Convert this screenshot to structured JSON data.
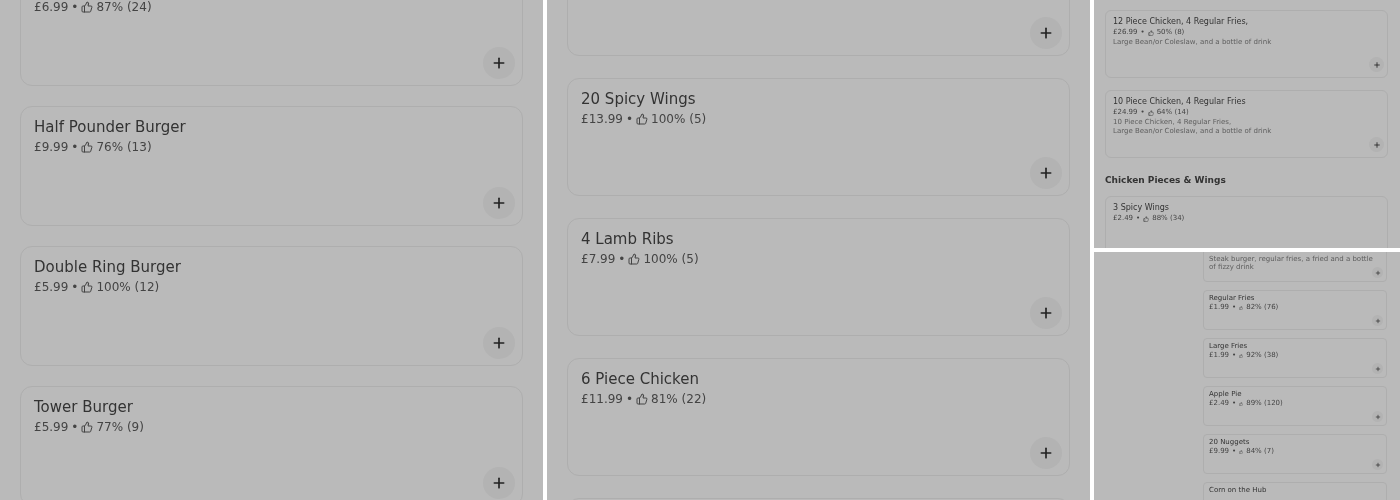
{
  "panels": [
    {
      "items": [
        {
          "kind": "item",
          "price": "£6.99",
          "rating": "87% (24)",
          "add_button": true
        },
        {
          "kind": "item",
          "name": "Half Pounder Burger",
          "price": "£9.99",
          "rating": "76% (13)",
          "add_button": true
        },
        {
          "kind": "item",
          "name": "Double Ring Burger",
          "price": "£5.99",
          "rating": "100% (12)",
          "add_button": true
        },
        {
          "kind": "item",
          "name": "Tower Burger",
          "price": "£5.99",
          "rating": "77% (9)",
          "add_button": true
        }
      ]
    },
    {
      "items": [
        {
          "kind": "item",
          "add_button": true
        },
        {
          "kind": "item",
          "name": "20 Spicy Wings",
          "price": "£13.99",
          "rating": "100% (5)",
          "add_button": true
        },
        {
          "kind": "item",
          "name": "4 Lamb Ribs",
          "price": "£7.99",
          "rating": "100% (5)",
          "add_button": true
        },
        {
          "kind": "item",
          "name": "6 Piece Chicken",
          "price": "£11.99",
          "rating": "81% (22)",
          "add_button": true
        },
        {
          "kind": "item"
        }
      ]
    },
    {
      "items": [
        {
          "kind": "item",
          "name": "12 Piece Chicken, 4 Regular Fries,",
          "price": "£26.99",
          "rating": "50% (8)",
          "description": "Large Bean/or Coleslaw, and a bottle of drink",
          "add_button": true
        },
        {
          "kind": "item",
          "name": "10 Piece Chicken, 4 Regular Fries",
          "price": "£24.99",
          "rating": "64% (14)",
          "description": "10 Piece Chicken, 4 Regular Fries,\nLarge Bean/or Coleslaw, and a bottle of drink",
          "add_button": true
        },
        {
          "kind": "heading",
          "name": "Chicken Pieces & Wings"
        },
        {
          "kind": "item",
          "name": "3 Spicy Wings",
          "price": "£2.49",
          "rating": "88% (34)"
        }
      ]
    },
    {
      "items": [
        {
          "kind": "item",
          "description": "Steak burger, regular fries, a fried and a bottle of fizzy drink",
          "add_button": true
        },
        {
          "kind": "item",
          "name": "Regular Fries",
          "price": "£1.99",
          "rating": "82% (76)",
          "add_button": true
        },
        {
          "kind": "item",
          "name": "Large Fries",
          "price": "£1.99",
          "rating": "92% (38)",
          "add_button": true
        },
        {
          "kind": "item",
          "name": "Apple Pie",
          "price": "£2.49",
          "rating": "89% (120)",
          "add_button": true
        },
        {
          "kind": "item",
          "name": "20 Nuggets",
          "price": "£9.99",
          "rating": "84% (7)",
          "add_button": true
        },
        {
          "kind": "item",
          "name": "Corn on the Hub"
        }
      ]
    }
  ],
  "separator": "•"
}
